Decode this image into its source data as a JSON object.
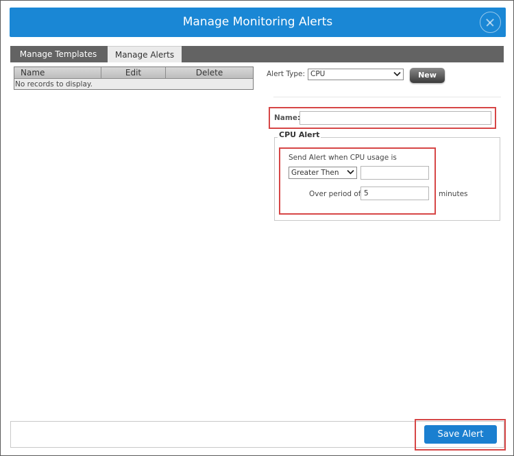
{
  "dialog": {
    "title": "Manage Monitoring Alerts",
    "accent_color": "#1a87d5",
    "highlight_color": "#d64545"
  },
  "tabs": [
    {
      "label": "Manage Templates",
      "active": false
    },
    {
      "label": "Manage Alerts",
      "active": true
    }
  ],
  "grid": {
    "columns": [
      "Name",
      "Edit",
      "Delete"
    ],
    "empty_message": "No records to display."
  },
  "alert_type": {
    "label": "Alert Type:",
    "selected": "CPU",
    "new_button": "New"
  },
  "name_field": {
    "label": "Name:",
    "value": ""
  },
  "cpu_alert": {
    "legend": "CPU Alert",
    "condition_label": "Send Alert when CPU usage is",
    "operator_selected": "Greater Then",
    "threshold_value": "",
    "period_label": "Over period of",
    "period_value": "5",
    "period_unit": "minutes"
  },
  "footer": {
    "save_label": "Save Alert"
  }
}
